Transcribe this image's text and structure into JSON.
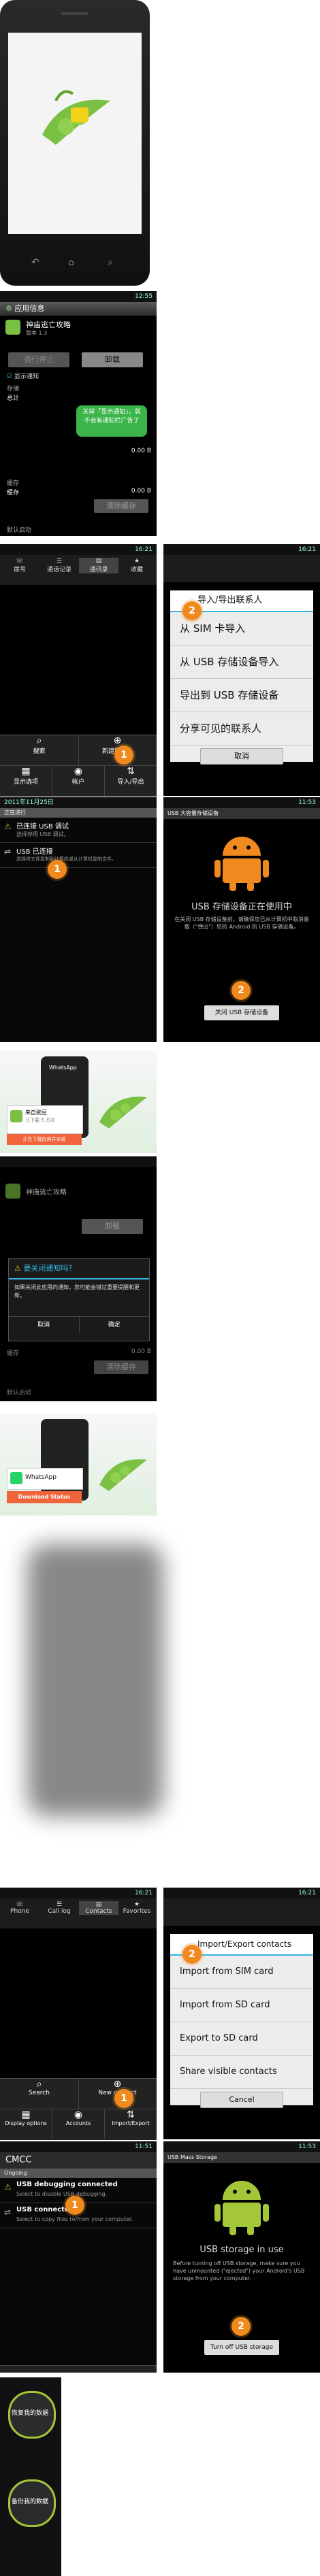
{
  "panel1": {
    "keys": [
      "back-key",
      "home-key",
      "search-key"
    ]
  },
  "panel2": {
    "status_time": "12:55",
    "app_info_title": "应用信息",
    "app_name": "神庙逃亡攻略",
    "app_version": "版本 1.3",
    "force_stop": "强行停止",
    "uninstall": "卸载",
    "show_notifications": "显示通知",
    "tip": "关掉「显示通知」，就不会有通知栏广告了",
    "storage_label": "存储",
    "total_label": "总计",
    "total_value": "0.00 B",
    "cache_header": "缓存",
    "cache_label": "缓存",
    "cache_value": "0.00 B",
    "clear_cache": "清除缓存",
    "defaults_header": "默认启动"
  },
  "panel3_left": {
    "status_time": "16:21",
    "tabs": [
      "拨号",
      "通话记录",
      "通讯录",
      "收藏"
    ],
    "menu": [
      {
        "label": "搜索",
        "icon": "search-icon"
      },
      {
        "label": "新建联系人",
        "icon": "add-contact-icon"
      },
      {
        "label": "显示选项",
        "icon": "display-options-icon"
      },
      {
        "label": "帐户",
        "icon": "accounts-icon"
      },
      {
        "label": "导入/导出",
        "icon": "import-export-icon"
      }
    ],
    "step": "1"
  },
  "panel3_right": {
    "status_time": "16:21",
    "dialog_title": "导入/导出联系人",
    "options": [
      "从 SIM 卡导入",
      "从 USB 存储设备导入",
      "导出到 USB 存储设备",
      "分享可见的联系人"
    ],
    "cancel": "取消",
    "step": "2"
  },
  "panel4_left": {
    "status_date": "2011年11月25日",
    "ongoing": "正在进行",
    "notif1_title": "已连接 USB 调试",
    "notif1_sub": "选择停用 USB 调试。",
    "notif2_title": "USB 已连接",
    "notif2_sub": "选择将文件复制到计算机或从计算机复制文件。",
    "step": "1"
  },
  "panel4_right": {
    "status_time": "11:53",
    "title_bar": "USB 大容量存储设备",
    "headline": "USB 存储设备正在使用中",
    "desc": "在关闭 USB 存储设备前，请确保您已从计算机中取消装载（\"弹出\"）您的 Android 的 USB 存储设备。",
    "button": "关闭 USB 存储设备",
    "step": "2"
  },
  "panel5": {
    "brand": "WhatsApp",
    "app_title": "来自豌豆",
    "app_sub": "已下载 5 万次",
    "download_status": "正在下载应用并安装"
  },
  "panel6": {
    "app_name": "神庙逃亡攻略",
    "uninstall": "卸载",
    "dialog_title": "要关闭通知吗？",
    "dialog_body": "如果关闭此应用的通知，您可能会错过重要提醒和更新。",
    "cancel": "取消",
    "ok": "确定",
    "cache_label": "缓存",
    "cache_value": "0.00 B",
    "clear_cache": "清除缓存",
    "defaults_header": "默认启动"
  },
  "panel7": {
    "brand": "WhatsApp",
    "download_status": "Download Status"
  },
  "panel8": {},
  "panel9_left": {
    "status_time": "16:21",
    "tabs": [
      "Phone",
      "Call log",
      "Contacts",
      "Favorites"
    ],
    "menu": [
      {
        "label": "Search",
        "icon": "search-icon"
      },
      {
        "label": "New contact",
        "icon": "add-contact-icon"
      },
      {
        "label": "Display options",
        "icon": "display-options-icon"
      },
      {
        "label": "Accounts",
        "icon": "accounts-icon"
      },
      {
        "label": "Import/Export",
        "icon": "import-export-icon"
      }
    ],
    "step": "1"
  },
  "panel9_right": {
    "status_time": "16:21",
    "dialog_title": "Import/Export contacts",
    "options": [
      "Import from SIM card",
      "Import from SD card",
      "Export to SD card",
      "Share visible contacts"
    ],
    "cancel": "Cancel",
    "step": "2"
  },
  "panel10_left": {
    "status_time": "11:51",
    "carrier": "CMCC",
    "ongoing": "Ongoing",
    "notif1_title": "USB debugging connected",
    "notif1_sub": "Select to disable USB debugging.",
    "notif2_title": "USB connected",
    "notif2_sub": "Select to copy files to/from your computer.",
    "step": "1"
  },
  "panel10_right": {
    "status_time": "11:53",
    "title_bar": "USB Mass Storage",
    "headline": "USB storage in use",
    "desc": "Before turning off USB storage, make sure you have unmounted (\"ejected\") your Android's USB storage from your computer.",
    "button": "Turn off USB storage",
    "step": "2"
  },
  "panel11": {
    "label_top": "恢复我的数据",
    "label_bottom": "备份我的数据"
  },
  "colors": {
    "accent_orange": "#f08a1f",
    "android_green": "#a4c639",
    "tip_green": "#3bb54a",
    "ics_blue": "#33b5e5"
  }
}
